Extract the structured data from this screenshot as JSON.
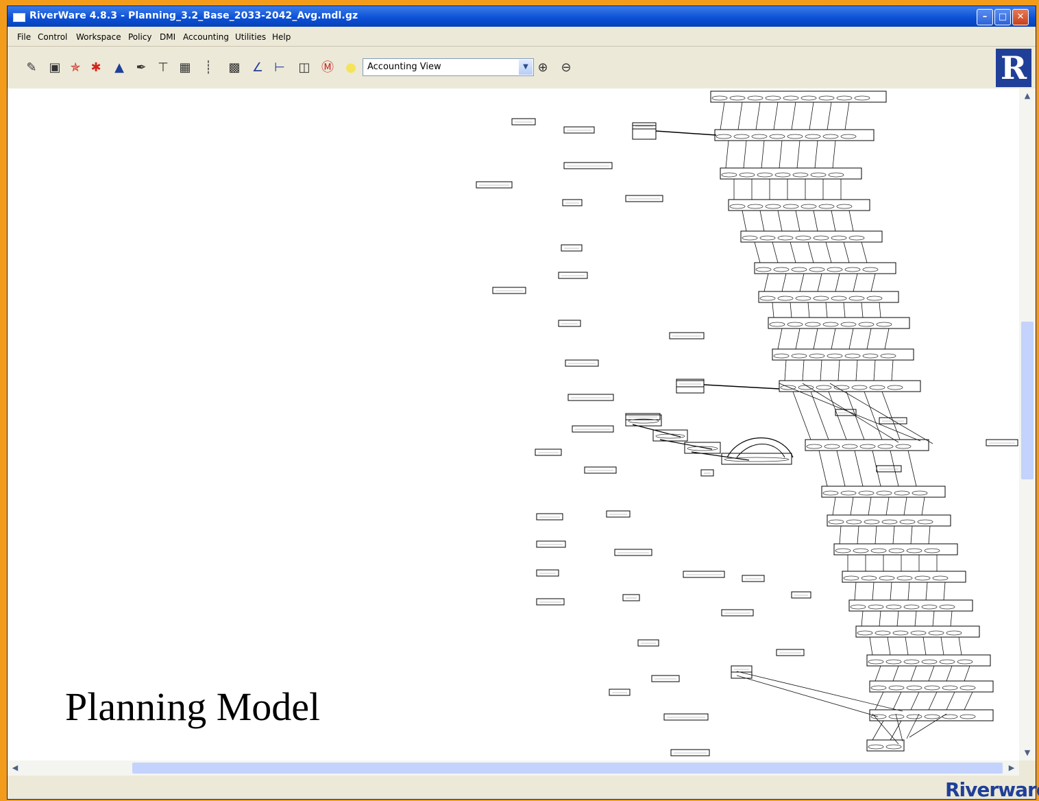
{
  "window": {
    "title": "RiverWare 4.8.3 - Planning_3.2_Base_2033-2042_Avg.mdl.gz",
    "controls": [
      "minimize",
      "maximize",
      "close"
    ]
  },
  "menubar": {
    "items": [
      "File",
      "Control",
      "Workspace",
      "Policy",
      "DMI",
      "Accounting",
      "Utilities",
      "Help"
    ]
  },
  "toolbar": {
    "icons": [
      "open-icon",
      "save-icon",
      "run-icon",
      "multi-run-icon",
      "triangle-icon",
      "pencil-icon",
      "link-icon",
      "grid-icon",
      "chart-icon",
      "network-icon",
      "plot-icon",
      "report-icon",
      "database-icon",
      "dmi-icon",
      "light-icon"
    ],
    "view_select": "Accounting View",
    "zoom_in": "zoom-in-icon",
    "zoom_out": "zoom-out-icon"
  },
  "canvas": {
    "caption": "Planning Model"
  },
  "status": {
    "brand": "Riverware"
  },
  "colors": {
    "title_bar": "#0a4fd6",
    "background": "#f39c1c",
    "brand": "#1f3f98"
  }
}
